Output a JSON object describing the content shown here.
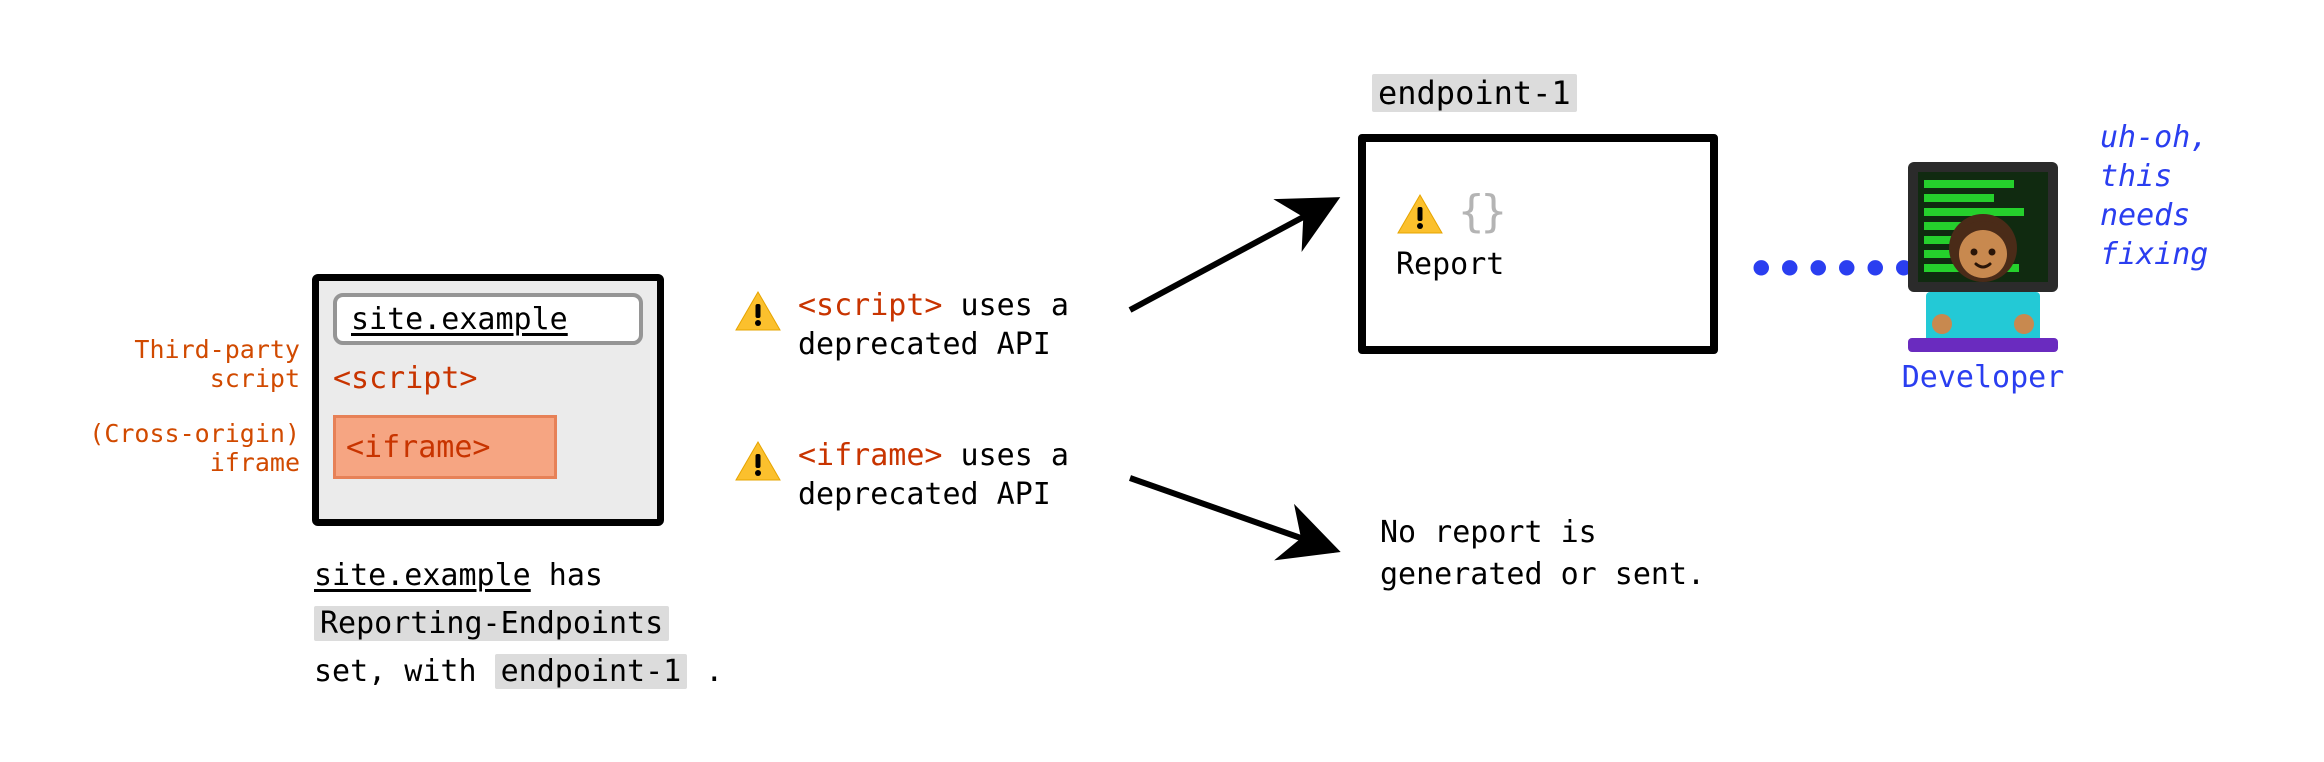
{
  "side_labels": {
    "script": "Third-party\nscript",
    "iframe": "(Cross-origin)\niframe"
  },
  "browser": {
    "url": "site.example",
    "script_tag": "<script>",
    "iframe_tag": "<iframe>"
  },
  "caption": {
    "site": "site.example",
    "has": " has ",
    "header": "Reporting-Endpoints",
    "set_with": "set, with ",
    "endpoint": "endpoint-1",
    "period": " ."
  },
  "msg1": {
    "code": "<script>",
    "rest": " uses a deprecated API"
  },
  "msg2": {
    "code": "<iframe>",
    "rest": " uses a deprecated API"
  },
  "endpoint": {
    "label": "endpoint-1",
    "braces": "{}",
    "report": "Report"
  },
  "no_report": "No report is generated or sent.",
  "dots": "••••••",
  "developer": {
    "label": "Developer",
    "uhoh": "uh-oh,\nthis\nneeds\nfixing"
  },
  "icons": {
    "warning": "warning-triangle"
  }
}
